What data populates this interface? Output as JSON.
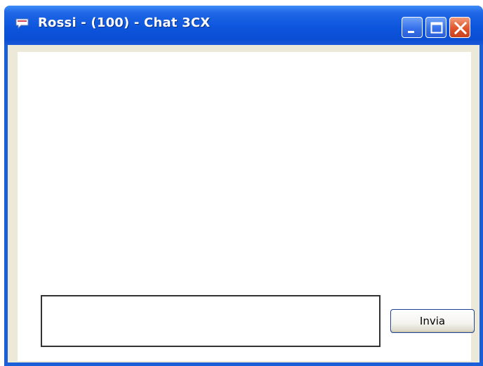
{
  "window": {
    "title": "Rossi - (100) - Chat 3CX",
    "icon": "chat-bubble-icon"
  },
  "titlebar_buttons": {
    "minimize": "minimize-icon",
    "maximize": "maximize-icon",
    "close": "close-icon"
  },
  "chat": {
    "message_value": "",
    "send_label": "Invia"
  },
  "colors": {
    "titlebar": "#0d55dc",
    "client_background": "#ece9d8",
    "close_button": "#e0552c"
  }
}
